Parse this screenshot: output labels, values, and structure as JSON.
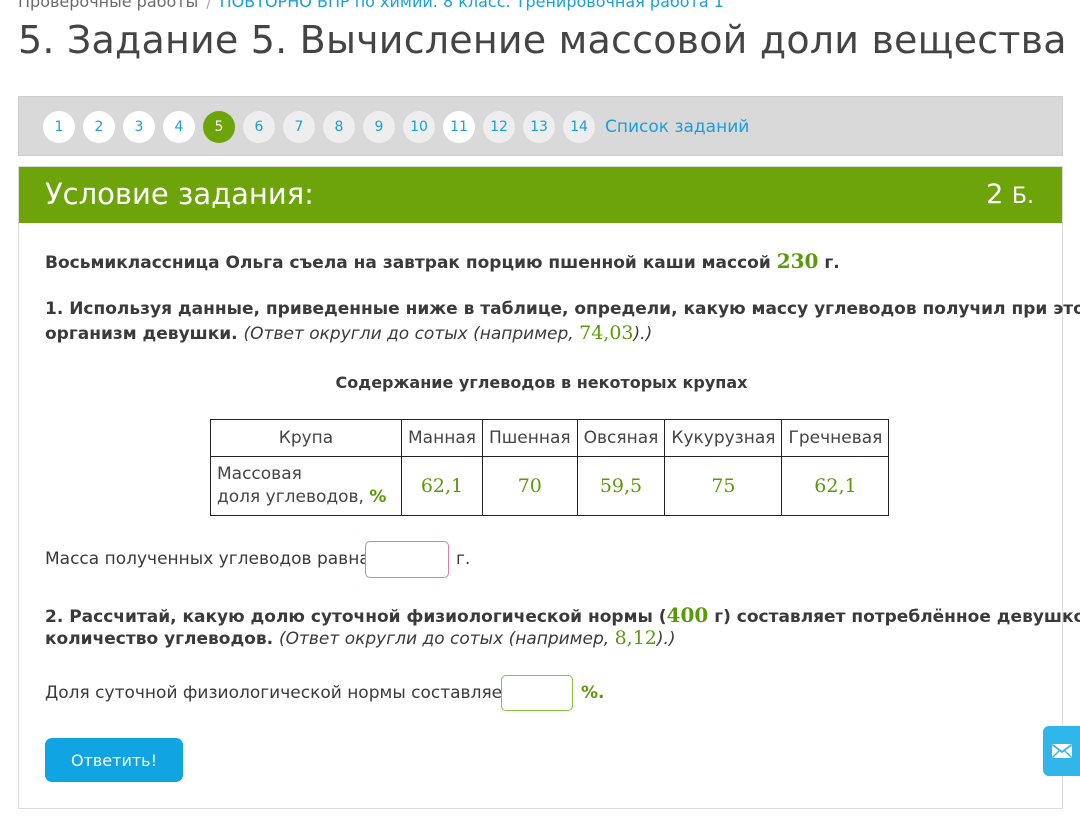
{
  "breadcrumb": {
    "root": "Проверочные работы",
    "separator": "/",
    "current": "ПОВТОРНО ВПР по химии. 8 класс. Тренировочная работа 1"
  },
  "page_title": "5. Задание 5. Вычисление массовой доли вещества",
  "task_nav": {
    "numbers": [
      "1",
      "2",
      "3",
      "4",
      "5",
      "6",
      "7",
      "8",
      "9",
      "10",
      "11",
      "12",
      "13",
      "14"
    ],
    "active": "5",
    "list_link": "Список заданий"
  },
  "panel": {
    "title": "Условие задания:",
    "points_value": "2",
    "points_unit": "Б."
  },
  "intro": {
    "text": "Восьмиклассница Ольга съела на завтрак порцию пшенной каши массой",
    "mass": "230",
    "unit": "г."
  },
  "q1": {
    "line1": "1. Используя данные, приведенные ниже в таблице, определи, какую массу углеводов получил при этом",
    "line2": "организм девушки.",
    "hint_pre": "(Ответ округли до сотых (например,",
    "hint_num": "74,03",
    "hint_post": ").)"
  },
  "table": {
    "caption": "Содержание углеводов в некоторых крупах",
    "header_label": "Крупа",
    "columns": [
      "Манная",
      "Пшенная",
      "Овсяная",
      "Кукурузная",
      "Гречневая"
    ],
    "row_label_line1": "Массовая",
    "row_label_line2": "доля углеводов,",
    "row_label_unit": "%",
    "values": [
      "62,1",
      "70",
      "59,5",
      "75",
      "62,1"
    ]
  },
  "answer1": {
    "label": "Масса полученных углеводов равна",
    "value": "",
    "unit": "г."
  },
  "q2": {
    "pre": "2. Рассчитай, какую долю суточной физиологической нормы (",
    "norm": "400",
    "post": "г) составляет потреблённое девушкой",
    "line2": "количество углеводов.",
    "hint_pre": "(Ответ округли до сотых (например,",
    "hint_num": "8,12",
    "hint_post": ").)"
  },
  "answer2": {
    "label": "Доля суточной физиологической нормы составляет",
    "value": "",
    "unit": "%."
  },
  "submit_label": "Ответить!",
  "colors": {
    "accent_green": "#6ca40a",
    "link_blue": "#1a9fd9",
    "button_blue": "#10a4e2"
  }
}
